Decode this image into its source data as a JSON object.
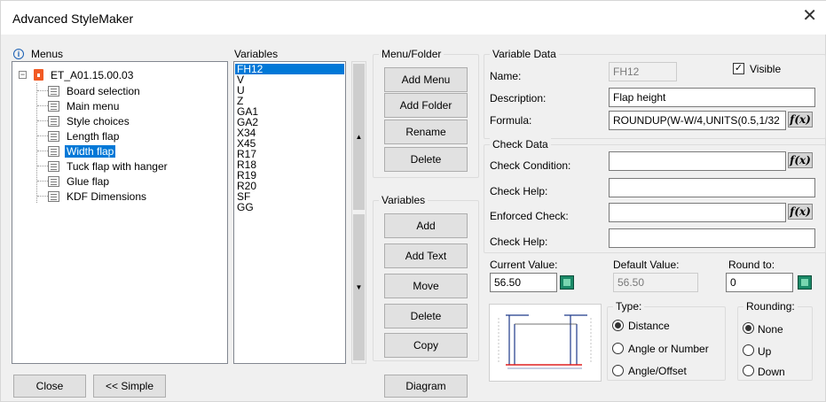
{
  "window": {
    "title": "Advanced StyleMaker",
    "close_glyph": "✕"
  },
  "menus": {
    "header": "Menus",
    "root": "ET_A01.15.00.03",
    "items": [
      "Board selection",
      "Main menu",
      "Style choices",
      "Length flap",
      "Width flap",
      "Tuck flap with hanger",
      "Glue flap",
      "KDF Dimensions"
    ],
    "selected": "Width flap"
  },
  "variables": {
    "header": "Variables",
    "items": [
      "FH12",
      "V",
      "U",
      "Z",
      "GA1",
      "GA2",
      "X34",
      "X45",
      "R17",
      "R18",
      "R19",
      "R20",
      "SF",
      "GG"
    ],
    "selected": "FH12"
  },
  "menu_folder": {
    "title": "Menu/Folder",
    "add_menu": "Add Menu",
    "add_folder": "Add Folder",
    "rename": "Rename",
    "delete": "Delete"
  },
  "var_buttons": {
    "title": "Variables",
    "add": "Add",
    "add_text": "Add Text",
    "move": "Move",
    "delete": "Delete",
    "copy": "Copy"
  },
  "variable_data": {
    "title": "Variable Data",
    "name_label": "Name:",
    "name_value": "FH12",
    "visible_label": "Visible",
    "visible_checked": true,
    "description_label": "Description:",
    "description_value": "Flap height",
    "formula_label": "Formula:",
    "formula_value": "ROUNDUP(W-W/4,UNITS(0.5,1/32"
  },
  "check_data": {
    "title": "Check Data",
    "check_condition_label": "Check Condition:",
    "check_help_label": "Check Help:",
    "enforced_check_label": "Enforced Check:",
    "check_help_label2": "Check Help:"
  },
  "values": {
    "current_label": "Current Value:",
    "current_value": "56.50",
    "default_label": "Default Value:",
    "default_value": "56.50",
    "round_label": "Round to:",
    "round_value": "0"
  },
  "type": {
    "title": "Type:",
    "options": [
      "Distance",
      "Angle or Number",
      "Angle/Offset"
    ],
    "selected": "Distance"
  },
  "rounding": {
    "title": "Rounding:",
    "options": [
      "None",
      "Up",
      "Down"
    ],
    "selected": "None"
  },
  "fx_label": "f(x)",
  "bottom": {
    "close": "Close",
    "simple": "<< Simple",
    "diagram": "Diagram"
  },
  "colors": {
    "selection": "#0078d7",
    "diagram_line": "#1f3a8a",
    "diagram_base": "#e02020"
  }
}
